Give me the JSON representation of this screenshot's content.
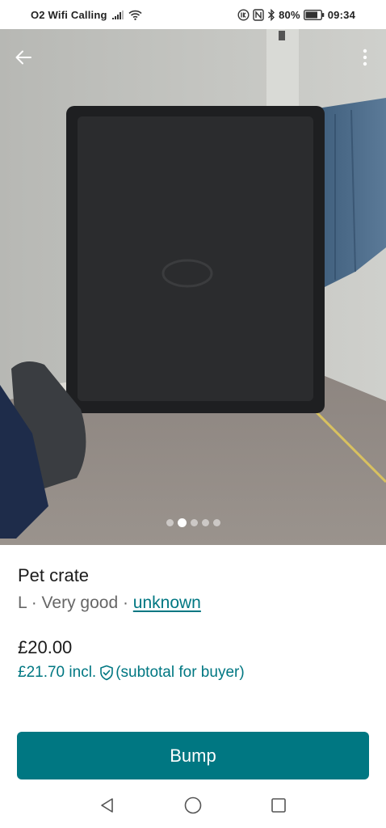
{
  "status_bar": {
    "carrier": "O2 Wifi Calling",
    "battery": "80%",
    "time": "09:34",
    "icons": [
      "signal-icon",
      "wifi-icon",
      "volte-icon",
      "nfc-icon",
      "bluetooth-icon",
      "battery-icon"
    ]
  },
  "gallery": {
    "photo_count": 5,
    "active_index": 1,
    "back_icon": "arrow-left-icon",
    "more_icon": "more-vertical-icon"
  },
  "item": {
    "title": "Pet crate",
    "size_condition": "L · Very good · ",
    "brand": "unknown",
    "price": "£20.00",
    "price_incl": "£21.70",
    "incl_label": "incl.",
    "incl_note": "(subtotal for buyer)"
  },
  "actions": {
    "bump_label": "Bump"
  },
  "colors": {
    "accent": "#007782",
    "text": "#1b1b1b",
    "muted": "#666666"
  },
  "nav": {
    "icons": [
      "back-triangle-icon",
      "home-circle-icon",
      "recents-square-icon"
    ]
  }
}
